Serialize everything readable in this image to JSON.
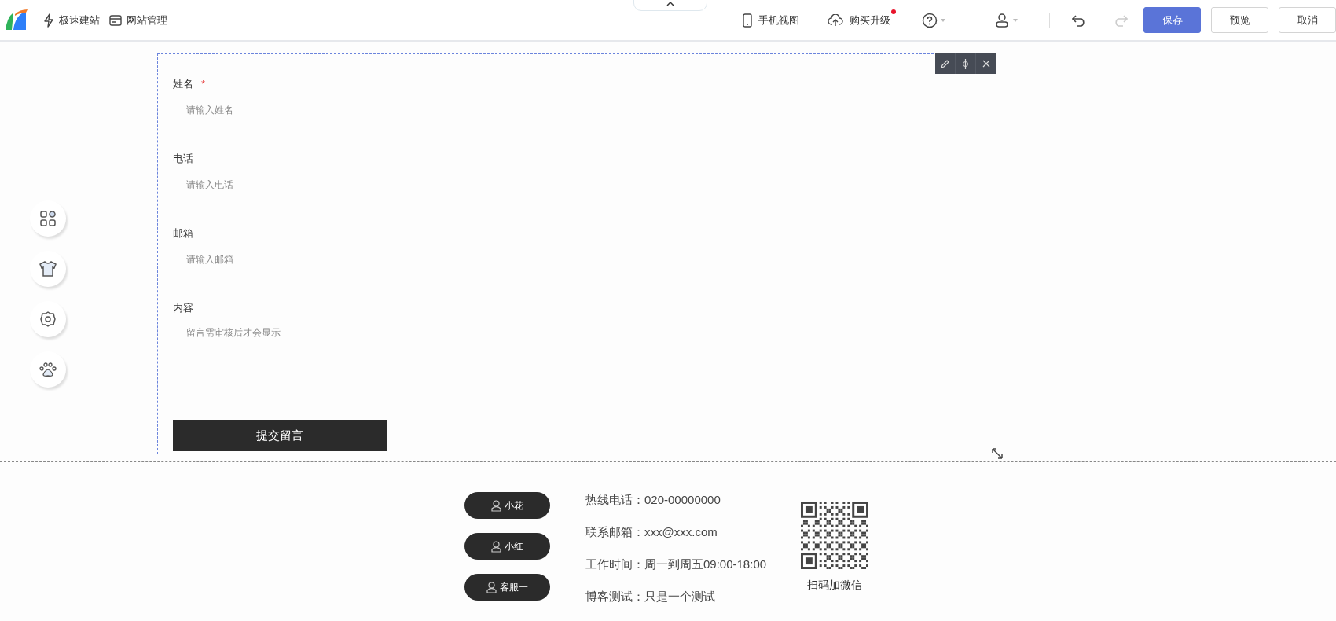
{
  "top_bar": {
    "left_items": [
      {
        "label": "极速建站"
      },
      {
        "label": "网站管理"
      }
    ],
    "right_items": [
      {
        "label": "手机视图",
        "badge": false
      },
      {
        "label": "购买升级",
        "badge": true
      }
    ],
    "history": {
      "undo_disabled": false,
      "redo_disabled": true
    },
    "buttons": [
      {
        "label": "保存",
        "kind": "primary"
      },
      {
        "label": "预览",
        "kind": "default"
      },
      {
        "label": "取消",
        "kind": "default"
      }
    ]
  },
  "form": {
    "fields": [
      {
        "label": "姓名",
        "required": true,
        "kind": "text",
        "placeholder": "请输入姓名"
      },
      {
        "label": "电话",
        "required": false,
        "kind": "text",
        "placeholder": "请输入电话"
      },
      {
        "label": "邮箱",
        "required": false,
        "kind": "text",
        "placeholder": "请输入邮箱"
      },
      {
        "label": "内容",
        "required": false,
        "kind": "textarea",
        "placeholder": "留言需审核后才会显示"
      }
    ],
    "required_mark": "*",
    "submit": "提交留言"
  },
  "footer": {
    "contacts": [
      "小花",
      "小红",
      "客服一"
    ],
    "info": [
      "热线电话：020-00000000",
      "联系邮箱：xxx@xxx.com",
      "工作时间：周一到周五09:00-18:00",
      "博客测试：只是一个测试"
    ],
    "qr_caption": "扫码加微信"
  }
}
